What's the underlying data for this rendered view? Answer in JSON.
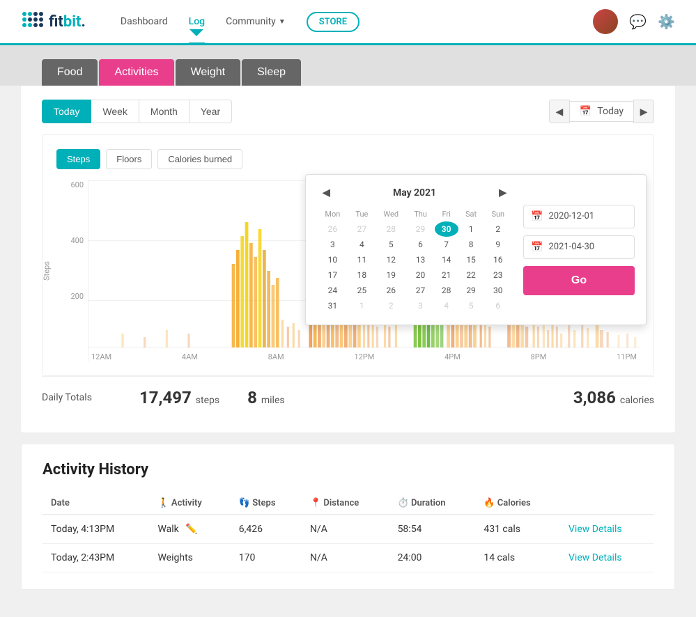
{
  "header": {
    "logo_text": "fitbit",
    "nav": [
      {
        "label": "Dashboard",
        "active": false
      },
      {
        "label": "Log",
        "active": true
      },
      {
        "label": "Community",
        "active": false,
        "has_arrow": true
      },
      {
        "label": "STORE",
        "is_store": true
      }
    ]
  },
  "tabs": [
    {
      "label": "Food",
      "active": false
    },
    {
      "label": "Activities",
      "active": true
    },
    {
      "label": "Weight",
      "active": false
    },
    {
      "label": "Sleep",
      "active": false
    }
  ],
  "period": {
    "buttons": [
      "Today",
      "Week",
      "Month",
      "Year"
    ],
    "active": "Today",
    "current_date": "Today"
  },
  "chart": {
    "tabs": [
      "Steps",
      "Floors",
      "Calories burned"
    ],
    "active_tab": "Steps",
    "y_labels": [
      "600",
      "400",
      "200",
      ""
    ],
    "y_label_text": "Steps",
    "x_labels": [
      "12AM",
      "4AM",
      "8AM",
      "12PM",
      "4PM",
      "8PM",
      "11PM"
    ]
  },
  "calendar": {
    "title": "May 2021",
    "days_header": [
      "Mon",
      "Tue",
      "Wed",
      "Thu",
      "Fri",
      "Sat",
      "Sun"
    ],
    "weeks": [
      [
        "26",
        "27",
        "28",
        "29",
        "30",
        "1",
        "2"
      ],
      [
        "3",
        "4",
        "5",
        "6",
        "7",
        "8",
        "9"
      ],
      [
        "10",
        "11",
        "12",
        "13",
        "14",
        "15",
        "16"
      ],
      [
        "17",
        "18",
        "19",
        "20",
        "21",
        "22",
        "23"
      ],
      [
        "24",
        "25",
        "26",
        "27",
        "28",
        "29",
        "30"
      ],
      [
        "31",
        "1",
        "2",
        "3",
        "4",
        "5",
        "6"
      ]
    ],
    "today_date": "30",
    "other_month_first": [
      "26",
      "27",
      "28",
      "29"
    ],
    "other_month_last": [
      "1",
      "2",
      "3",
      "4",
      "5",
      "6"
    ],
    "date_from": "2020-12-01",
    "date_to": "2021-04-30",
    "go_label": "Go"
  },
  "daily_totals": {
    "label": "Daily Totals",
    "steps_value": "17,497",
    "steps_unit": "steps",
    "miles_value": "8",
    "miles_unit": "miles",
    "calories_value": "3,086",
    "calories_unit": "calories"
  },
  "activity_history": {
    "title": "Activity History",
    "columns": [
      {
        "label": "Date",
        "icon": ""
      },
      {
        "label": "Activity",
        "icon": "🚶"
      },
      {
        "label": "Steps",
        "icon": "👣"
      },
      {
        "label": "Distance",
        "icon": "📍"
      },
      {
        "label": "Duration",
        "icon": "⏱️"
      },
      {
        "label": "Calories",
        "icon": "🔥"
      },
      {
        "label": "",
        "icon": ""
      }
    ],
    "rows": [
      {
        "date": "Today, 4:13PM",
        "activity": "Walk",
        "steps": "6,426",
        "distance": "N/A",
        "duration": "58:54",
        "calories": "431 cals",
        "link": "View Details"
      },
      {
        "date": "Today, 2:43PM",
        "activity": "Weights",
        "steps": "170",
        "distance": "N/A",
        "duration": "24:00",
        "calories": "14 cals",
        "link": "View Details"
      }
    ]
  }
}
